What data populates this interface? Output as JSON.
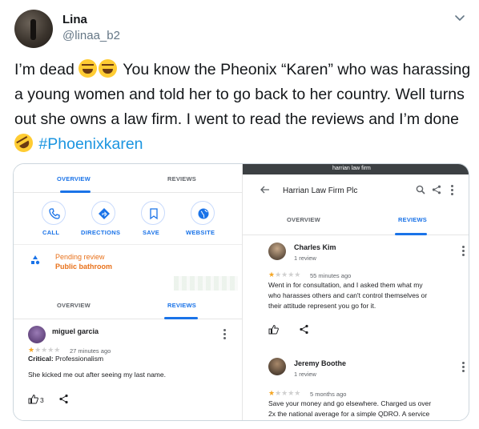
{
  "tweet": {
    "display_name": "Lina",
    "handle": "@linaa_b2",
    "text_part1": "I’m dead ",
    "text_part2": " You know the Pheonix “Karen” who was harassing a young women and told her to go back to her country. Well turns out she owns a law firm. I  went to read the reviews and I’m done ",
    "hashtag": "#Phoenixkaren",
    "icons": [
      "face-with-tears-of-joy-emoji",
      "face-with-tears-of-joy-emoji",
      "rolling-on-floor-laughing-emoji",
      "chevron-down-icon"
    ]
  },
  "left_screenshot": {
    "tabs_top": {
      "overview": "OVERVIEW",
      "reviews": "REVIEWS"
    },
    "actions": {
      "call": "CALL",
      "directions": "DIRECTIONS",
      "save": "SAVE",
      "website": "WEBSITE"
    },
    "pending": {
      "line1": "Pending review",
      "line2": "Public bathroom"
    },
    "tabs_bottom": {
      "overview": "OVERVIEW",
      "reviews": "REVIEWS"
    },
    "review": {
      "name": "miguel garcia",
      "time": "27 minutes ago",
      "critical_label": "Critical:",
      "critical_value": "Professionalism",
      "body": "She kicked me out after seeing my last name.",
      "likes": "3"
    }
  },
  "right_screenshot": {
    "url": "harrian law firm",
    "firm_name": "Harrian Law Firm Plc",
    "tabs": {
      "overview": "OVERVIEW",
      "reviews": "REVIEWS"
    },
    "reviews": [
      {
        "name": "Charles Kim",
        "sub": "1 review",
        "time": "55 minutes ago",
        "body": [
          "Went in for consultation, and I asked them what my",
          "who harasses others and can't control themselves or",
          "their attitude represent you go for it."
        ]
      },
      {
        "name": "Jeremy Boothe",
        "sub": "1 review",
        "time": "5 months ago",
        "body": [
          "Save your money and go elsewhere. Charged us over",
          "2x the national average for a simple QDRO.  A service"
        ]
      }
    ]
  },
  "colors": {
    "link": "#1b95e0",
    "google_blue": "#1a73e8",
    "star": "#f5a623",
    "pending": "#e8711a"
  }
}
